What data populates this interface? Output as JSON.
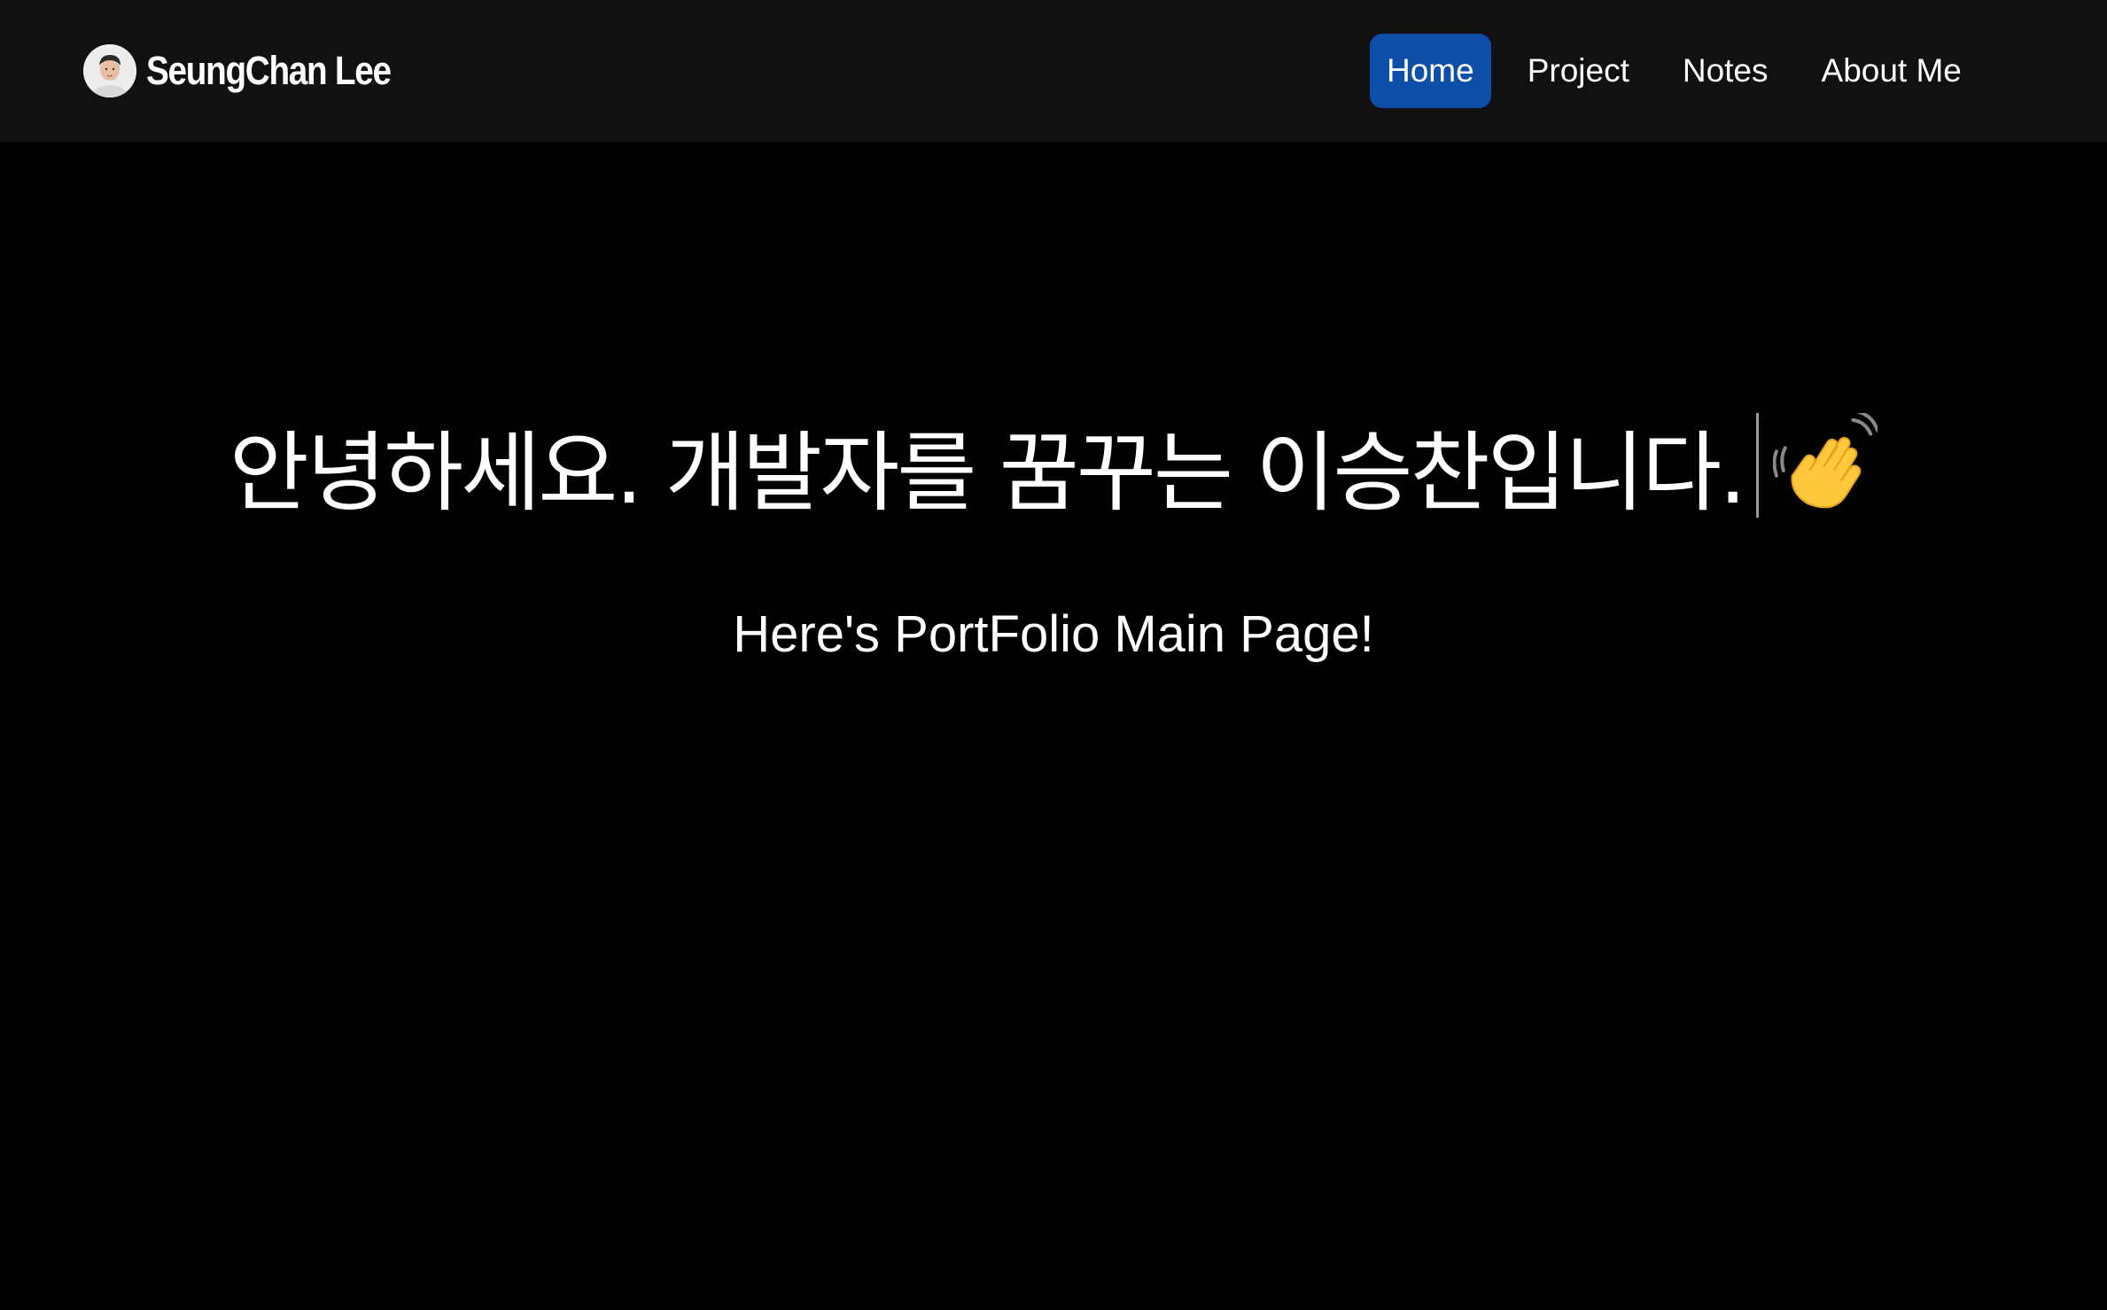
{
  "header": {
    "brand_name": "SeungChan Lee",
    "avatar": "profile-photo",
    "nav": [
      {
        "label": "Home",
        "active": true
      },
      {
        "label": "Project",
        "active": false
      },
      {
        "label": "Notes",
        "active": false
      },
      {
        "label": "About Me",
        "active": false
      }
    ]
  },
  "hero": {
    "title": "안녕하세요. 개발자를 꿈꾸는 이승찬입니다.",
    "emoji_icon": "waving-hand-icon",
    "subtitle": "Here's PortFolio Main Page!"
  },
  "colors": {
    "page_background": "#000000",
    "navbar_background": "#111111",
    "active_nav_background": "#0d4fa8",
    "text": "#ffffff",
    "caret": "#9a9a9a"
  }
}
